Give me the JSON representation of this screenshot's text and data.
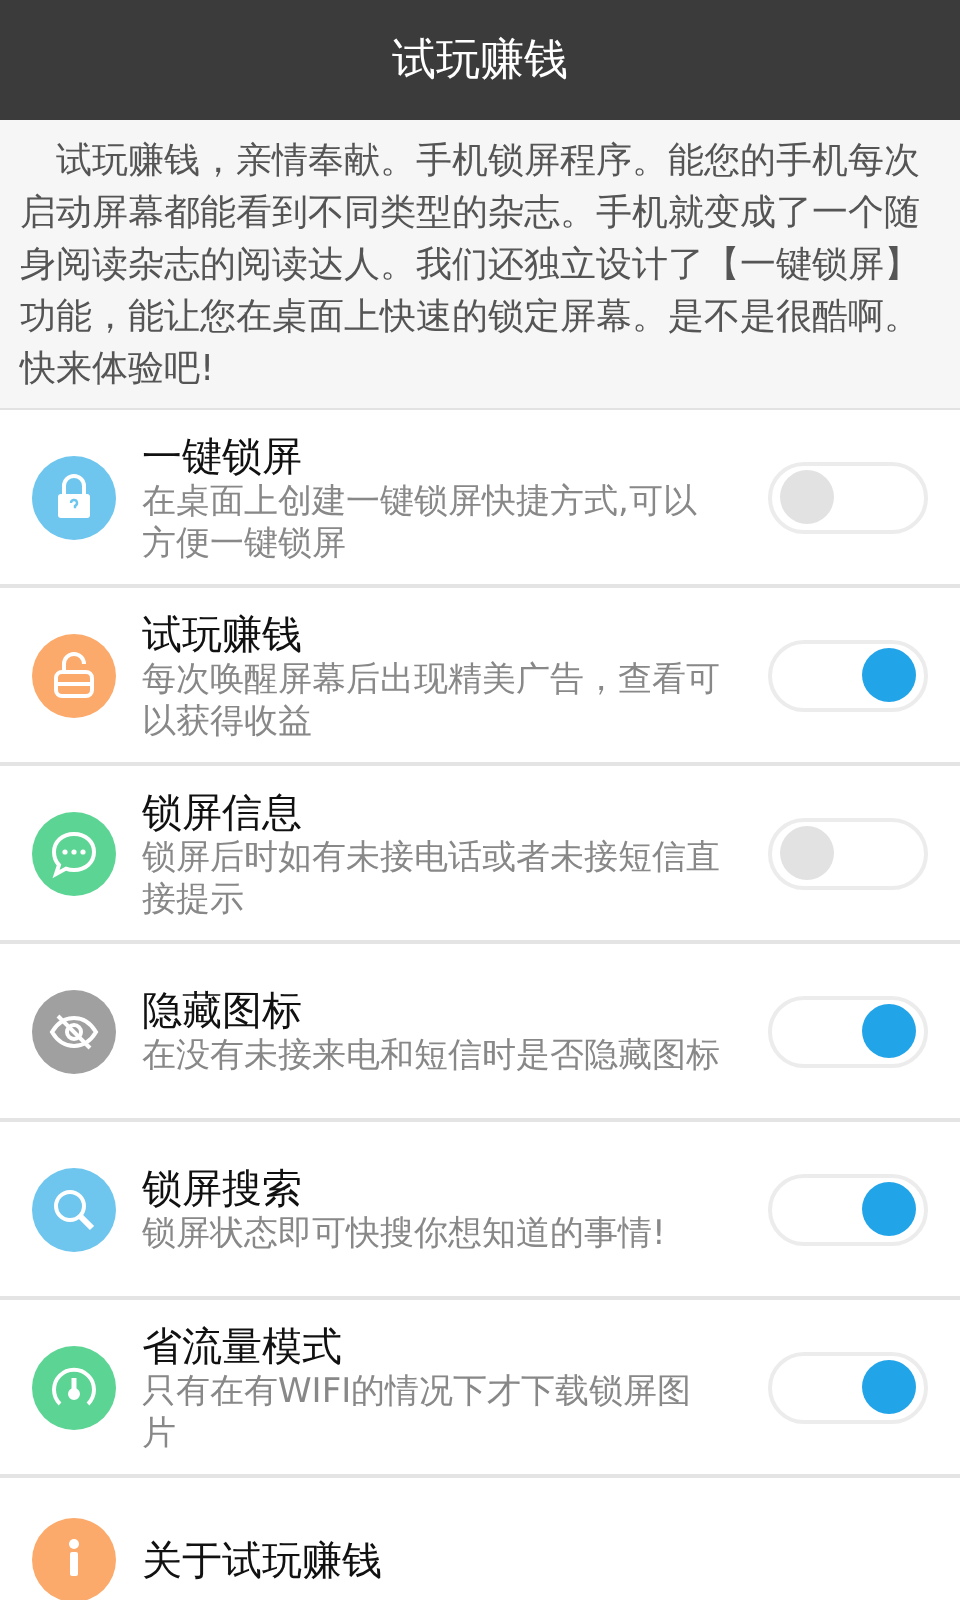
{
  "header": {
    "title": "试玩赚钱"
  },
  "intro": "试玩赚钱，亲情奉献。手机锁屏程序。能您的手机每次启动屏幕都能看到不同类型的杂志。手机就变成了一个随身阅读杂志的阅读达人。我们还独立设计了【一键锁屏】功能，能让您在桌面上快速的锁定屏幕。是不是很酷啊。快来体验吧!",
  "settings": [
    {
      "kind": "lock",
      "color": "#6ec6ee",
      "title": "一键锁屏",
      "description": "在桌面上创建一键锁屏快捷方式,可以方便一键锁屏",
      "on": false
    },
    {
      "kind": "unlock",
      "color": "#fbaa6b",
      "title": "试玩赚钱",
      "description": "每次唤醒屏幕后出现精美广告，查看可以获得收益",
      "on": true
    },
    {
      "kind": "chat",
      "color": "#5cd494",
      "title": "锁屏信息",
      "description": "锁屏后时如有未接电话或者未接短信直接提示",
      "on": false
    },
    {
      "kind": "eye",
      "color": "#a0a0a0",
      "title": "隐藏图标",
      "description": "在没有未接来电和短信时是否隐藏图标",
      "on": true
    },
    {
      "kind": "search",
      "color": "#6ec6ee",
      "title": "锁屏搜索",
      "description": "锁屏状态即可快搜你想知道的事情!",
      "on": true
    },
    {
      "kind": "gauge",
      "color": "#5cd494",
      "title": "省流量模式",
      "description": "只有在有WIFI的情况下才下载锁屏图片",
      "on": true
    }
  ],
  "about": {
    "kind": "info",
    "color": "#fbaa6b",
    "title": "关于试玩赚钱"
  }
}
